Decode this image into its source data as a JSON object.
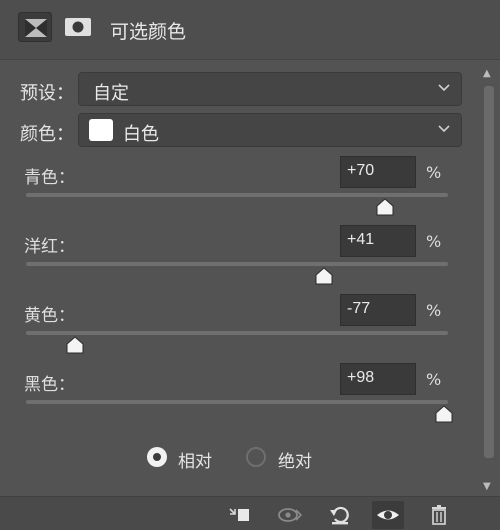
{
  "header": {
    "title": "可选颜色",
    "icons": [
      "adjustment-icon",
      "mask-icon"
    ]
  },
  "preset": {
    "label": "预设：",
    "value": "自定"
  },
  "colors": {
    "label": "颜色：",
    "value": "白色",
    "swatch_color": "#ffffff"
  },
  "sliders": [
    {
      "label": "青色：",
      "value": "+70",
      "unit": "%",
      "level": 70
    },
    {
      "label": "洋红：",
      "value": "+41",
      "unit": "%",
      "level": 41
    },
    {
      "label": "黄色：",
      "value": "-77",
      "unit": "%",
      "level": -77
    },
    {
      "label": "黑色：",
      "value": "+98",
      "unit": "%",
      "level": 98
    }
  ],
  "method": {
    "options": [
      {
        "label": "相对",
        "selected": true
      },
      {
        "label": "绝对",
        "selected": false
      }
    ]
  },
  "footer": {
    "icons": [
      "clip-to-layer-icon",
      "view-previous-icon",
      "reset-icon",
      "visibility-eye-icon",
      "delete-trash-icon"
    ]
  }
}
